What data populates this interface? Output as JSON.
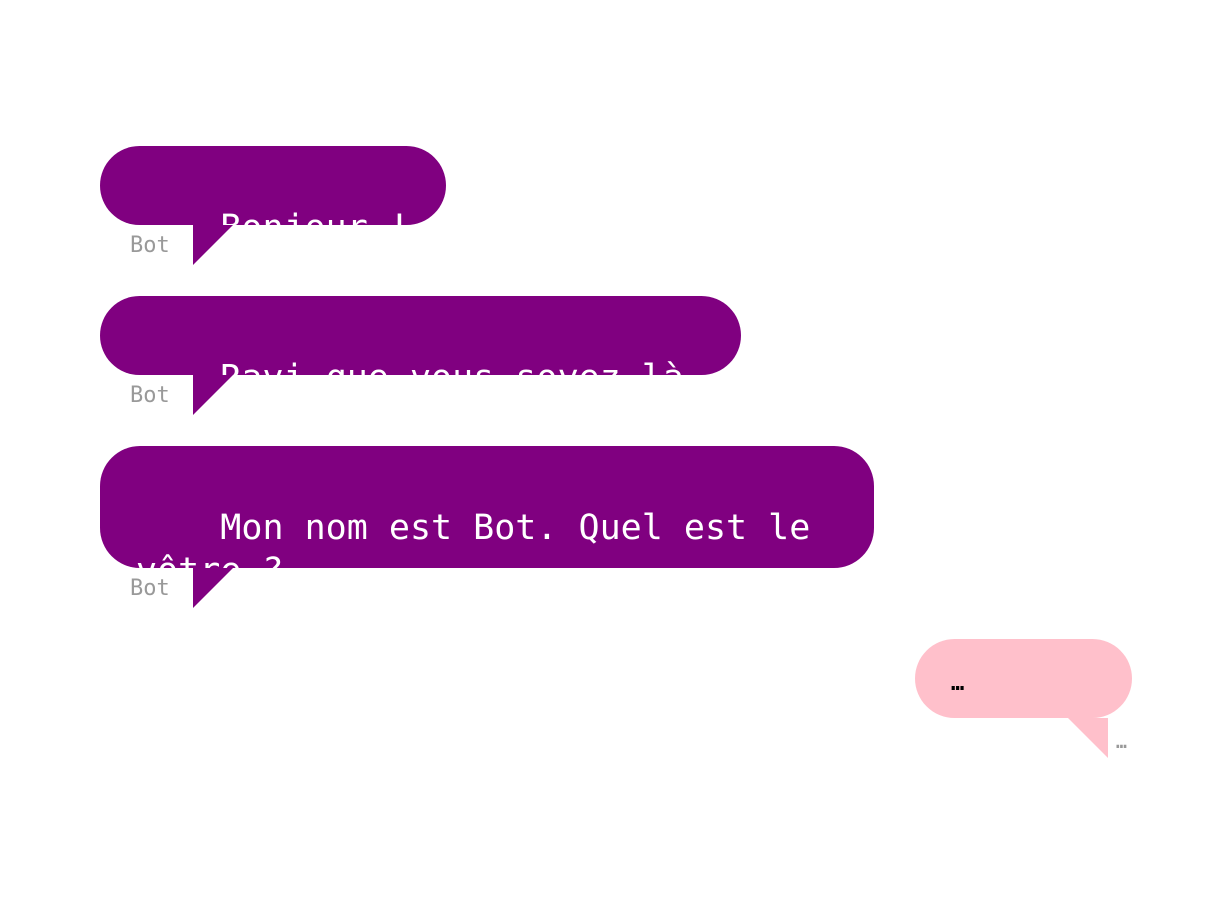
{
  "colors": {
    "bot_bubble": "#800080",
    "user_bubble": "#ffc0cb",
    "sender_label": "#999999",
    "background": "#ffffff"
  },
  "messages": [
    {
      "role": "bot",
      "text": "Bonjour !",
      "sender": "Bot"
    },
    {
      "role": "bot",
      "text": "Ravi que vous soyez là.",
      "sender": "Bot"
    },
    {
      "role": "bot",
      "text": "Mon nom est Bot. Quel est le\nvôtre ?",
      "sender": "Bot"
    },
    {
      "role": "user",
      "text": "…",
      "sender": "…"
    }
  ]
}
